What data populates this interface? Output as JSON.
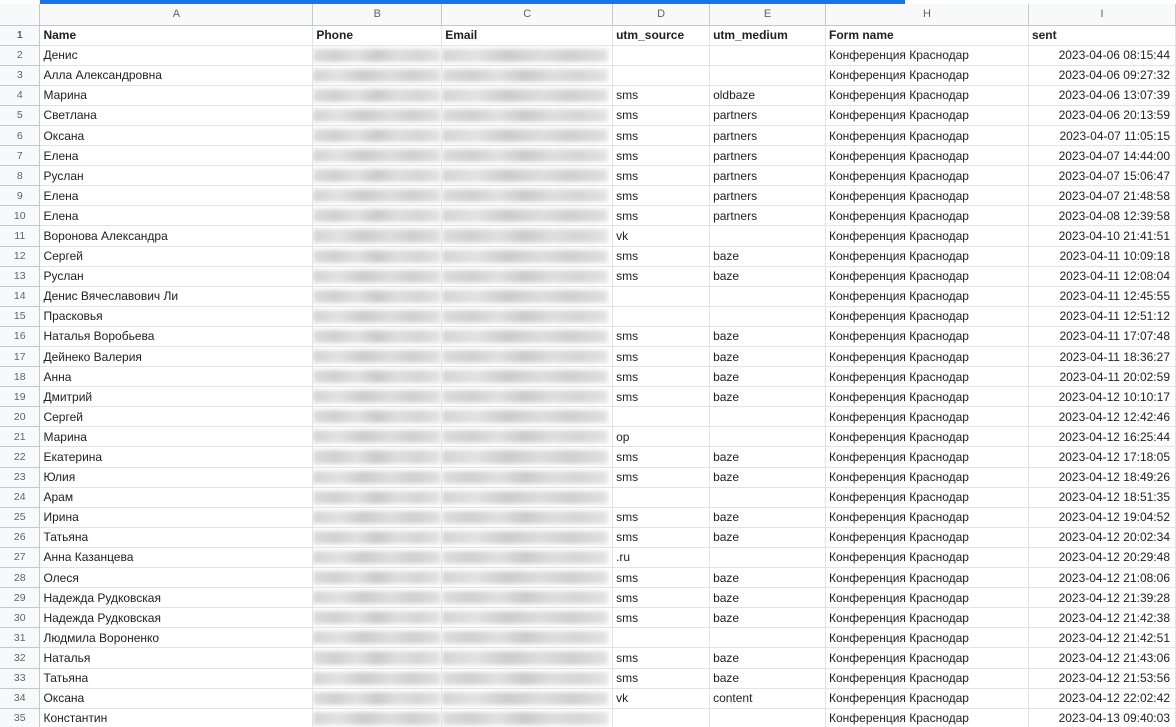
{
  "columns": [
    "A",
    "B",
    "C",
    "D",
    "E",
    "H",
    "I"
  ],
  "header": {
    "row_number": "1",
    "name": "Name",
    "phone": "Phone",
    "email": "Email",
    "utm_source": "utm_source",
    "utm_medium": "utm_medium",
    "form_name": "Form name",
    "sent": "sent"
  },
  "rows": [
    {
      "n": "2",
      "name": "Денис",
      "src": "",
      "med": "",
      "form": "Конференция Краснодар",
      "sent": "2023-04-06 08:15:44"
    },
    {
      "n": "3",
      "name": "Алла Александровна",
      "src": "",
      "med": "",
      "form": "Конференция Краснодар",
      "sent": "2023-04-06 09:27:32"
    },
    {
      "n": "4",
      "name": "Марина",
      "src": "sms",
      "med": "oldbaze",
      "form": "Конференция Краснодар",
      "sent": "2023-04-06 13:07:39"
    },
    {
      "n": "5",
      "name": "Светлана",
      "src": "sms",
      "med": "partners",
      "form": "Конференция Краснодар",
      "sent": "2023-04-06 20:13:59"
    },
    {
      "n": "6",
      "name": "Оксана",
      "src": "sms",
      "med": "partners",
      "form": "Конференция Краснодар",
      "sent": "2023-04-07 11:05:15"
    },
    {
      "n": "7",
      "name": "Елена",
      "src": "sms",
      "med": "partners",
      "form": "Конференция Краснодар",
      "sent": "2023-04-07 14:44:00"
    },
    {
      "n": "8",
      "name": "Руслан",
      "src": "sms",
      "med": "partners",
      "form": "Конференция Краснодар",
      "sent": "2023-04-07 15:06:47"
    },
    {
      "n": "9",
      "name": "Елена",
      "src": "sms",
      "med": "partners",
      "form": "Конференция Краснодар",
      "sent": "2023-04-07 21:48:58"
    },
    {
      "n": "10",
      "name": "Елена",
      "src": "sms",
      "med": "partners",
      "form": "Конференция Краснодар",
      "sent": "2023-04-08 12:39:58"
    },
    {
      "n": "11",
      "name": "Воронова Александра",
      "src": "vk",
      "med": "",
      "form": "Конференция Краснодар",
      "sent": "2023-04-10 21:41:51"
    },
    {
      "n": "12",
      "name": "Сергей",
      "src": "sms",
      "med": "baze",
      "form": "Конференция Краснодар",
      "sent": "2023-04-11 10:09:18"
    },
    {
      "n": "13",
      "name": "Руслан",
      "src": "sms",
      "med": "baze",
      "form": "Конференция Краснодар",
      "sent": "2023-04-11 12:08:04"
    },
    {
      "n": "14",
      "name": "Денис Вячеславович Ли",
      "src": "",
      "med": "",
      "form": "Конференция Краснодар",
      "sent": "2023-04-11 12:45:55"
    },
    {
      "n": "15",
      "name": "Прасковья",
      "src": "",
      "med": "",
      "form": "Конференция Краснодар",
      "sent": "2023-04-11 12:51:12"
    },
    {
      "n": "16",
      "name": "Наталья Воробьева",
      "src": "sms",
      "med": "baze",
      "form": "Конференция Краснодар",
      "sent": "2023-04-11 17:07:48"
    },
    {
      "n": "17",
      "name": "Дейнеко Валерия",
      "src": "sms",
      "med": "baze",
      "form": "Конференция Краснодар",
      "sent": "2023-04-11 18:36:27"
    },
    {
      "n": "18",
      "name": "Анна",
      "src": "sms",
      "med": "baze",
      "form": "Конференция Краснодар",
      "sent": "2023-04-11 20:02:59"
    },
    {
      "n": "19",
      "name": "Дмитрий",
      "src": "sms",
      "med": "baze",
      "form": "Конференция Краснодар",
      "sent": "2023-04-12 10:10:17"
    },
    {
      "n": "20",
      "name": "Сергей",
      "src": "",
      "med": "",
      "form": "Конференция Краснодар",
      "sent": "2023-04-12 12:42:46"
    },
    {
      "n": "21",
      "name": "Марина",
      "src": "op",
      "med": "",
      "form": "Конференция Краснодар",
      "sent": "2023-04-12 16:25:44"
    },
    {
      "n": "22",
      "name": "Екатерина",
      "src": "sms",
      "med": "baze",
      "form": "Конференция Краснодар",
      "sent": "2023-04-12 17:18:05"
    },
    {
      "n": "23",
      "name": "Юлия",
      "src": "sms",
      "med": "baze",
      "form": "Конференция Краснодар",
      "sent": "2023-04-12 18:49:26"
    },
    {
      "n": "24",
      "name": "Арам",
      "src": "",
      "med": "",
      "form": "Конференция Краснодар",
      "sent": "2023-04-12 18:51:35"
    },
    {
      "n": "25",
      "name": "Ирина",
      "src": "sms",
      "med": "baze",
      "form": "Конференция Краснодар",
      "sent": "2023-04-12 19:04:52"
    },
    {
      "n": "26",
      "name": "Татьяна",
      "src": "sms",
      "med": "baze",
      "form": "Конференция Краснодар",
      "sent": "2023-04-12 20:02:34"
    },
    {
      "n": "27",
      "name": "Анна Казанцева",
      "src": ".ru",
      "med": "",
      "form": "Конференция Краснодар",
      "sent": "2023-04-12 20:29:48"
    },
    {
      "n": "28",
      "name": "Олеся",
      "src": "sms",
      "med": "baze",
      "form": "Конференция Краснодар",
      "sent": "2023-04-12 21:08:06"
    },
    {
      "n": "29",
      "name": "Надежда Рудковская",
      "src": "sms",
      "med": "baze",
      "form": "Конференция Краснодар",
      "sent": "2023-04-12 21:39:28"
    },
    {
      "n": "30",
      "name": "Надежда Рудковская",
      "src": "sms",
      "med": "baze",
      "form": "Конференция Краснодар",
      "sent": "2023-04-12 21:42:38"
    },
    {
      "n": "31",
      "name": "Людмила Вороненко",
      "src": "",
      "med": "",
      "form": "Конференция Краснодар",
      "sent": "2023-04-12 21:42:51"
    },
    {
      "n": "32",
      "name": "Наталья",
      "src": "sms",
      "med": "baze",
      "form": "Конференция Краснодар",
      "sent": "2023-04-12 21:43:06"
    },
    {
      "n": "33",
      "name": "Татьяна",
      "src": "sms",
      "med": "baze",
      "form": "Конференция Краснодар",
      "sent": "2023-04-12 21:53:56"
    },
    {
      "n": "34",
      "name": "Оксана",
      "src": "vk",
      "med": "content",
      "form": "Конференция Краснодар",
      "sent": "2023-04-12 22:02:42"
    },
    {
      "n": "35",
      "name": "Константин",
      "src": "",
      "med": "",
      "form": "Конференция Краснодар",
      "sent": "2023-04-13 09:40:03"
    }
  ],
  "colors": {
    "accent": "#1a73e8",
    "header_bg": "#f8f9fa",
    "gridline": "#e2e3e3"
  }
}
